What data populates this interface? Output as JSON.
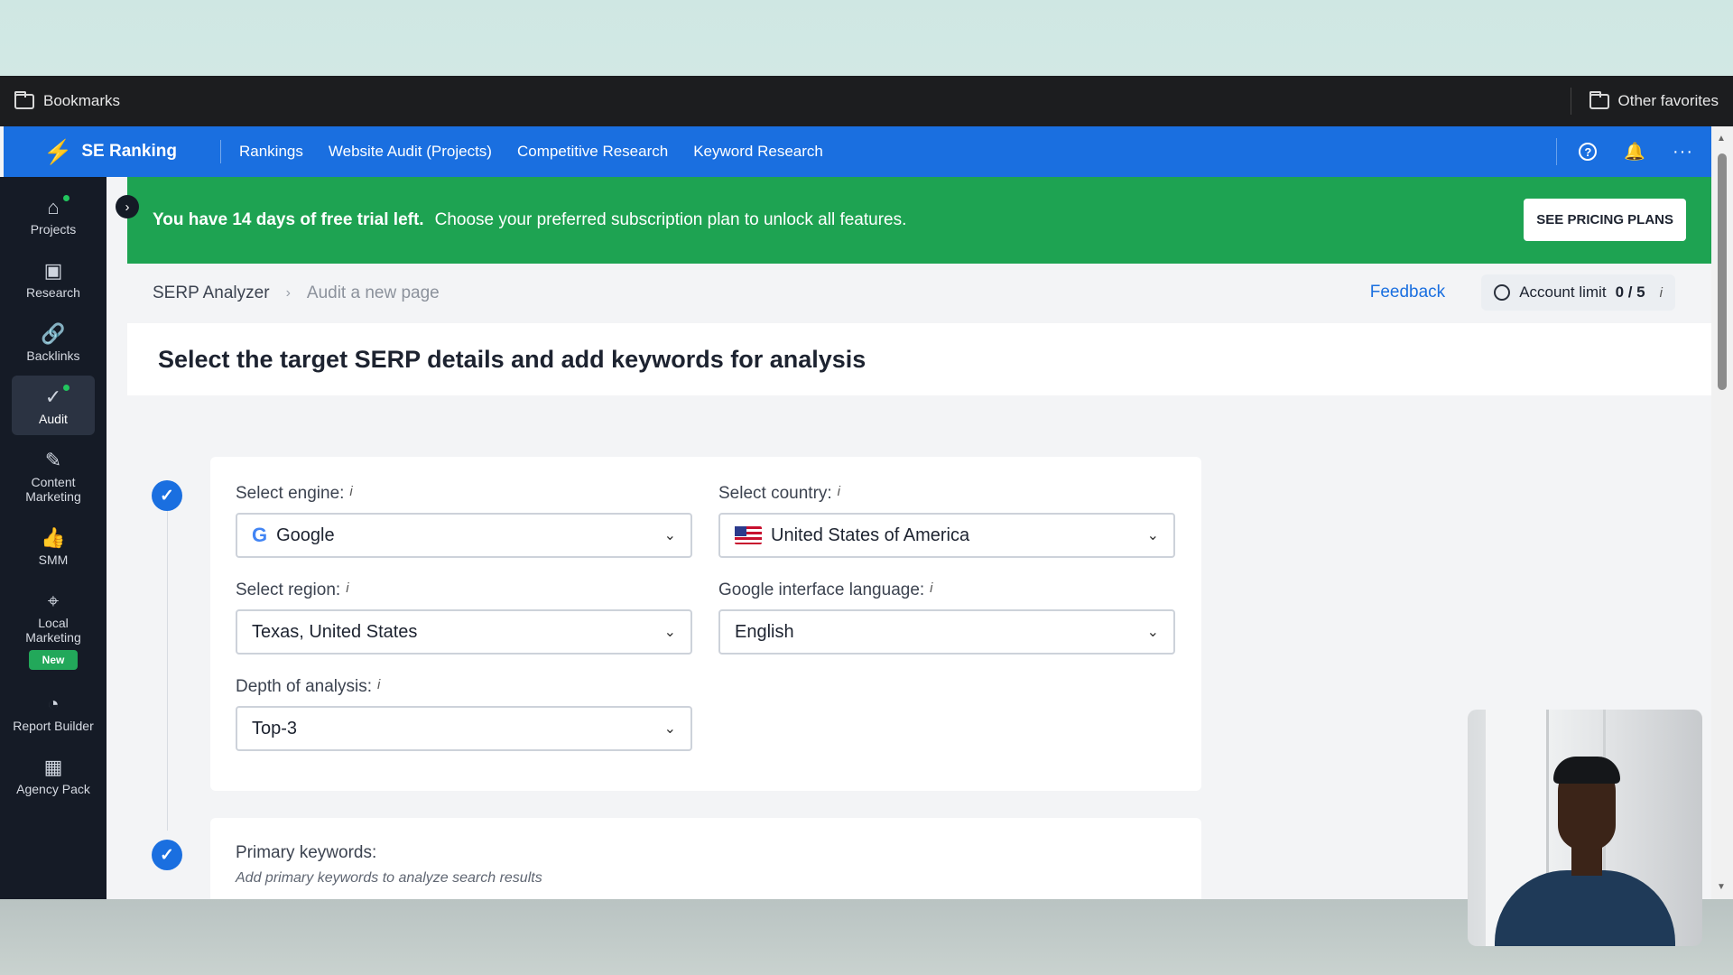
{
  "bookmarks_bar": {
    "left_label": "Bookmarks",
    "right_label": "Other favorites"
  },
  "topnav": {
    "brand": "SE Ranking",
    "links": [
      "Rankings",
      "Website Audit (Projects)",
      "Competitive Research",
      "Keyword Research"
    ],
    "icons": [
      "help-icon",
      "bell-icon",
      "more-icon"
    ]
  },
  "sidebar": {
    "items": [
      {
        "label": "Projects",
        "icon": "home-icon",
        "dot": true
      },
      {
        "label": "Research",
        "icon": "research-icon"
      },
      {
        "label": "Backlinks",
        "icon": "link-icon"
      },
      {
        "label": "Audit",
        "icon": "check-circle-icon",
        "active": true,
        "dot": true
      },
      {
        "label": "Content Marketing",
        "icon": "edit-icon"
      },
      {
        "label": "SMM",
        "icon": "thumbs-up-icon"
      },
      {
        "label": "Local Marketing",
        "icon": "pin-icon",
        "badge": "New"
      },
      {
        "label": "Report Builder",
        "icon": "pie-chart-icon"
      },
      {
        "label": "Agency Pack",
        "icon": "building-icon"
      }
    ]
  },
  "banner": {
    "bold": "You have 14 days of free trial left.",
    "text": "Choose your preferred subscription plan to unlock all features.",
    "button": "SEE PRICING PLANS",
    "color": "#1ea352"
  },
  "breadcrumb": {
    "root": "SERP Analyzer",
    "current": "Audit a new page",
    "feedback": "Feedback",
    "account_limit_label": "Account limit",
    "account_limit_value": "0 / 5"
  },
  "page": {
    "title": "Select the target SERP details and add keywords for analysis"
  },
  "form": {
    "engine": {
      "label": "Select engine:",
      "value": "Google"
    },
    "country": {
      "label": "Select country:",
      "value": "United States of America"
    },
    "region": {
      "label": "Select region:",
      "value": "Texas, United States"
    },
    "language": {
      "label": "Google interface language:",
      "value": "English"
    },
    "depth": {
      "label": "Depth of analysis:",
      "value": "Top-3"
    }
  },
  "keywords": {
    "label": "Primary keywords:",
    "hint": "Add primary keywords to analyze search results"
  },
  "colors": {
    "accent": "#1a6fe0",
    "sidebar": "#151b26",
    "banner": "#1ea352"
  }
}
